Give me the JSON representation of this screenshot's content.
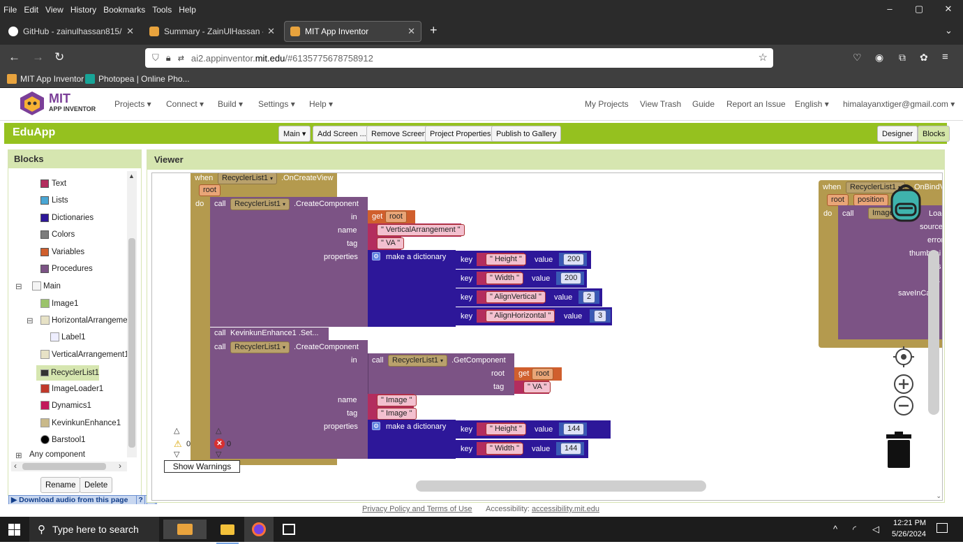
{
  "browser": {
    "menu": [
      "File",
      "Edit",
      "View",
      "History",
      "Bookmarks",
      "Tools",
      "Help"
    ],
    "window_controls": [
      "–",
      "▢",
      "✕"
    ],
    "tabs": [
      {
        "title": "GitHub - zainulhassan815/appi",
        "close": "✕"
      },
      {
        "title": "Summary - ZainUlHassan - MIT",
        "close": "✕"
      },
      {
        "title": "MIT App Inventor",
        "close": "✕"
      }
    ],
    "new_tab": "+",
    "url_host": "ai2.appinventor.",
    "url_domain": "mit.edu",
    "url_rest": "/#6135775678758912",
    "bookmarks": [
      "MIT App Inventor",
      "Photopea | Online Pho..."
    ]
  },
  "app": {
    "logo_main": "MIT",
    "logo_sub": "APP INVENTOR",
    "nav": [
      "Projects ▾",
      "Connect ▾",
      "Build ▾",
      "Settings ▾",
      "Help ▾"
    ],
    "right_nav": [
      "My Projects",
      "View Trash",
      "Guide",
      "Report an Issue",
      "English ▾",
      "himalayanxtiger@gmail.com ▾"
    ],
    "project_name": "EduApp",
    "toolbar": [
      "Main ▾",
      "Add Screen ...",
      "Remove Screen",
      "Project Properties",
      "Publish to Gallery"
    ],
    "mode_buttons": [
      "Designer",
      "Blocks"
    ]
  },
  "blocks_panel": {
    "title": "Blocks",
    "builtin": [
      {
        "label": "Text",
        "color": "#b32d5e"
      },
      {
        "label": "Lists",
        "color": "#49a6d4"
      },
      {
        "label": "Dictionaries",
        "color": "#2d1799"
      },
      {
        "label": "Colors",
        "color": "#7d7d7d"
      },
      {
        "label": "Variables",
        "color": "#d05f2d"
      },
      {
        "label": "Procedures",
        "color": "#7c5385"
      }
    ],
    "tree": [
      "Main",
      "Image1",
      "HorizontalArrangemen",
      "Label1",
      "VerticalArrangement1",
      "RecyclerList1",
      "ImageLoader1",
      "Dynamics1",
      "KevinkunEnhance1",
      "Barstool1"
    ],
    "any_component": "Any component",
    "tree_toggles": [
      "⊟",
      "⊟",
      "⊞"
    ],
    "scroll_arrows": [
      "▲",
      "‹",
      "›"
    ],
    "rename_button": "Rename",
    "delete_button": "Delete"
  },
  "download_bar": {
    "label": "Download audio from this page",
    "help": "?",
    "close": "X"
  },
  "viewer": {
    "title": "Viewer",
    "event_block": {
      "when": "when",
      "component": "RecyclerList1",
      "event": ".OnCreateView",
      "param": "root",
      "do": "do"
    },
    "call1": {
      "call": "call",
      "component": "RecyclerList1",
      "method": ".CreateComponent",
      "in_label": "in",
      "get": "get",
      "get_var": "root",
      "name_label": "name",
      "name_value": "VerticalArrangement",
      "tag_label": "tag",
      "tag_value": "VA",
      "properties_label": "properties",
      "dict_label": "make a dictionary",
      "pairs": [
        {
          "key": "Height",
          "value": "200"
        },
        {
          "key": "Width",
          "value": "200"
        },
        {
          "key": "AlignVertical",
          "value": "2"
        },
        {
          "key": "AlignHorizontal",
          "value": "3"
        }
      ]
    },
    "call2": {
      "call": "call",
      "text": "KevinkunEnhance1 .Set..."
    },
    "call3": {
      "call": "call",
      "component": "RecyclerList1",
      "method": ".CreateComponent",
      "in_label": "in",
      "get_component": {
        "call": "call",
        "component": "RecyclerList1",
        "method": ".GetComponent",
        "root_label": "root",
        "get": "get",
        "get_var": "root",
        "tag_label": "tag",
        "tag_value": "VA"
      },
      "name_label": "name",
      "name_value": "Image",
      "tag_label": "tag",
      "tag_value": "Image",
      "properties_label": "properties",
      "dict_label": "make a dictionary",
      "pairs": [
        {
          "key": "Height",
          "value": "144"
        },
        {
          "key": "Width",
          "value": "144"
        }
      ]
    },
    "right_block": {
      "when": "when",
      "component": "RecyclerList1",
      "event_part": "OnBindVi",
      "params": [
        "root",
        "position"
      ],
      "do": "do",
      "call": "call",
      "callee": "ImageL",
      "method_part": "Load",
      "slots": [
        "source",
        "error",
        "thumbnai",
        "s",
        "ra",
        "saveInCa",
        "in"
      ]
    },
    "key_label": "key",
    "value_label": "value",
    "warnings": {
      "warn_count": "0",
      "error_count": "0",
      "show_label": "Show Warnings"
    }
  },
  "footer": {
    "privacy": "Privacy Policy and Terms of Use",
    "accessibility_label": "Accessibility:",
    "accessibility_link": "accessibility.mit.edu"
  },
  "taskbar": {
    "search_placeholder": "Type here to search",
    "time": "12:21 PM",
    "date": "5/26/2024"
  }
}
